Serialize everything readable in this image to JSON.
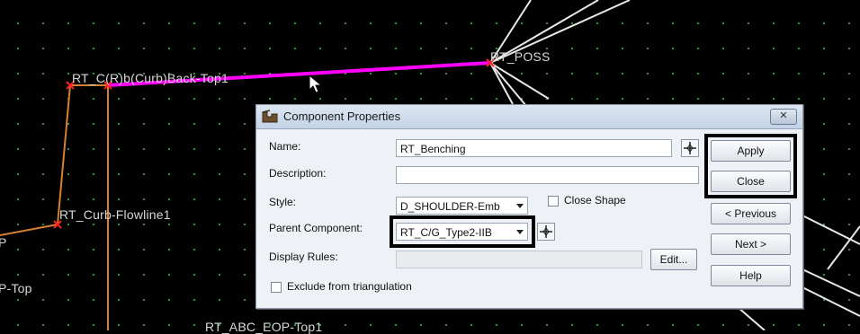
{
  "cad": {
    "point_labels": {
      "rt_poss": "RT_POSS",
      "rt_curb_back_top": "RT_C(R)b(Curb)Back-Top1",
      "rt_curb_flowline": "RT_Curb-Flowline1",
      "left_top": "P-Top",
      "left_edge": "P",
      "rt_abc_eop": "RT_ABC_EOP-Top1"
    },
    "colors": {
      "selected_component": "#ff00ff",
      "component_line": "#d98030",
      "point_marker": "#ff2020"
    }
  },
  "dialog": {
    "title": "Component Properties",
    "close_glyph": "✕",
    "name_label": "Name:",
    "name_value": "RT_Benching",
    "description_label": "Description:",
    "description_value": "",
    "style_label": "Style:",
    "style_value": "D_SHOULDER-Emb",
    "close_shape_label": "Close Shape",
    "close_shape_checked": false,
    "parent_label": "Parent Component:",
    "parent_value": "RT_C/G_Type2-IIB",
    "display_rules_label": "Display Rules:",
    "display_rules_value": "",
    "edit_label": "Edit...",
    "exclude_label": "Exclude from triangulation",
    "exclude_checked": false,
    "buttons": {
      "apply": "Apply",
      "close": "Close",
      "previous": "< Previous",
      "next": "Next >",
      "help": "Help"
    }
  }
}
